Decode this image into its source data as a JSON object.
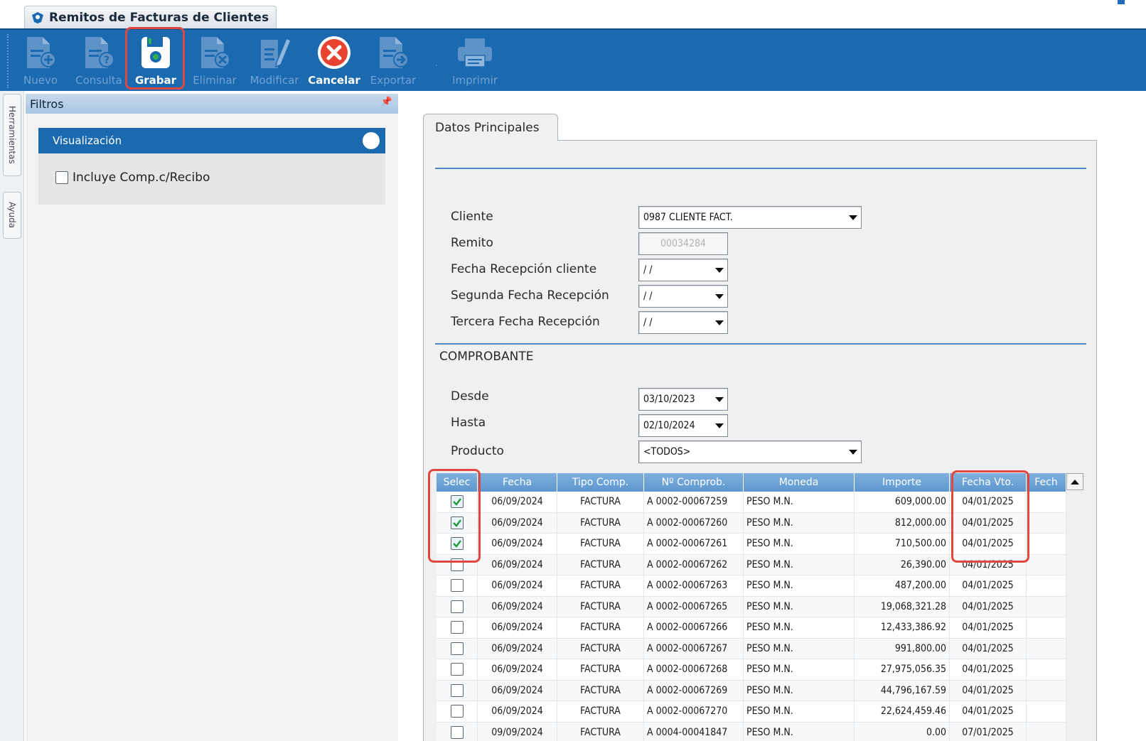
{
  "window": {
    "tab_title": "Remitos de Facturas de Clientes"
  },
  "toolbar": {
    "buttons": [
      {
        "label": "Nuevo",
        "icon": "doc-add-icon",
        "enabled": false
      },
      {
        "label": "Consulta",
        "icon": "doc-question-icon",
        "enabled": false
      },
      {
        "label": "Grabar",
        "icon": "save-disk-icon",
        "enabled": true
      },
      {
        "label": "Eliminar",
        "icon": "doc-delete-icon",
        "enabled": false
      },
      {
        "label": "Modificar",
        "icon": "doc-edit-icon",
        "enabled": false
      },
      {
        "label": "Cancelar",
        "icon": "cancel-circle-icon",
        "enabled": true
      },
      {
        "label": "Exportar",
        "icon": "doc-export-icon",
        "enabled": false
      },
      {
        "label": "Imprimir",
        "icon": "printer-icon",
        "enabled": false
      }
    ]
  },
  "side_tabs": {
    "tools": "Herramientas",
    "help": "Ayuda"
  },
  "filters": {
    "title": "Filtros",
    "visualizacion": {
      "title": "Visualización",
      "option_label": "Incluye Comp.c/Recibo",
      "option_checked": false
    }
  },
  "main": {
    "tab": "Datos Principales",
    "cliente_label": "Cliente",
    "cliente_value": "0987 CLIENTE FACT.",
    "remito_label": "Remito",
    "remito_value": "00034284",
    "fecha_recepcion_label": "Fecha Recepción cliente",
    "fecha_recepcion_value": "/ /",
    "segunda_fecha_label": "Segunda Fecha Recepción",
    "segunda_fecha_value": "/ /",
    "tercera_fecha_label": "Tercera Fecha Recepción",
    "tercera_fecha_value": "/ /",
    "comprobante_title": "COMPROBANTE",
    "desde_label": "Desde",
    "desde_value": "03/10/2023",
    "hasta_label": "Hasta",
    "hasta_value": "02/10/2024",
    "producto_label": "Producto",
    "producto_value": "<TODOS>"
  },
  "grid": {
    "columns": [
      "Selec",
      "Fecha",
      "Tipo Comp.",
      "Nº Comprob.",
      "Moneda",
      "Importe",
      "Fecha Vto.",
      "Fech"
    ],
    "rows": [
      {
        "selected": true,
        "fecha": "06/09/2024",
        "tipo": "FACTURA",
        "numero": "A 0002-00067259",
        "moneda": "PESO M.N.",
        "importe": "609,000.00",
        "vto": "04/01/2025"
      },
      {
        "selected": true,
        "fecha": "06/09/2024",
        "tipo": "FACTURA",
        "numero": "A 0002-00067260",
        "moneda": "PESO M.N.",
        "importe": "812,000.00",
        "vto": "04/01/2025"
      },
      {
        "selected": true,
        "fecha": "06/09/2024",
        "tipo": "FACTURA",
        "numero": "A 0002-00067261",
        "moneda": "PESO M.N.",
        "importe": "710,500.00",
        "vto": "04/01/2025"
      },
      {
        "selected": false,
        "fecha": "06/09/2024",
        "tipo": "FACTURA",
        "numero": "A 0002-00067262",
        "moneda": "PESO M.N.",
        "importe": "26,390.00",
        "vto": "04/01/2025"
      },
      {
        "selected": false,
        "fecha": "06/09/2024",
        "tipo": "FACTURA",
        "numero": "A 0002-00067263",
        "moneda": "PESO M.N.",
        "importe": "487,200.00",
        "vto": "04/01/2025"
      },
      {
        "selected": false,
        "fecha": "06/09/2024",
        "tipo": "FACTURA",
        "numero": "A 0002-00067265",
        "moneda": "PESO M.N.",
        "importe": "19,068,321.28",
        "vto": "04/01/2025"
      },
      {
        "selected": false,
        "fecha": "06/09/2024",
        "tipo": "FACTURA",
        "numero": "A 0002-00067266",
        "moneda": "PESO M.N.",
        "importe": "12,433,386.92",
        "vto": "04/01/2025"
      },
      {
        "selected": false,
        "fecha": "06/09/2024",
        "tipo": "FACTURA",
        "numero": "A 0002-00067267",
        "moneda": "PESO M.N.",
        "importe": "991,800.00",
        "vto": "04/01/2025"
      },
      {
        "selected": false,
        "fecha": "06/09/2024",
        "tipo": "FACTURA",
        "numero": "A 0002-00067268",
        "moneda": "PESO M.N.",
        "importe": "27,975,056.35",
        "vto": "04/01/2025"
      },
      {
        "selected": false,
        "fecha": "06/09/2024",
        "tipo": "FACTURA",
        "numero": "A 0002-00067269",
        "moneda": "PESO M.N.",
        "importe": "44,796,167.59",
        "vto": "04/01/2025"
      },
      {
        "selected": false,
        "fecha": "06/09/2024",
        "tipo": "FACTURA",
        "numero": "A 0002-00067270",
        "moneda": "PESO M.N.",
        "importe": "22,624,459.46",
        "vto": "04/01/2025"
      },
      {
        "selected": false,
        "fecha": "09/09/2024",
        "tipo": "FACTURA",
        "numero": "A 0004-00041847",
        "moneda": "PESO M.N.",
        "importe": "0.00",
        "vto": "07/01/2025"
      }
    ]
  },
  "colors": {
    "toolbar_blue": "#1b6ab0",
    "highlight_red": "#e0473e",
    "grid_header": "#6fa6d9",
    "cancel_red": "#e8432e",
    "check_green": "#1e9c3a"
  }
}
